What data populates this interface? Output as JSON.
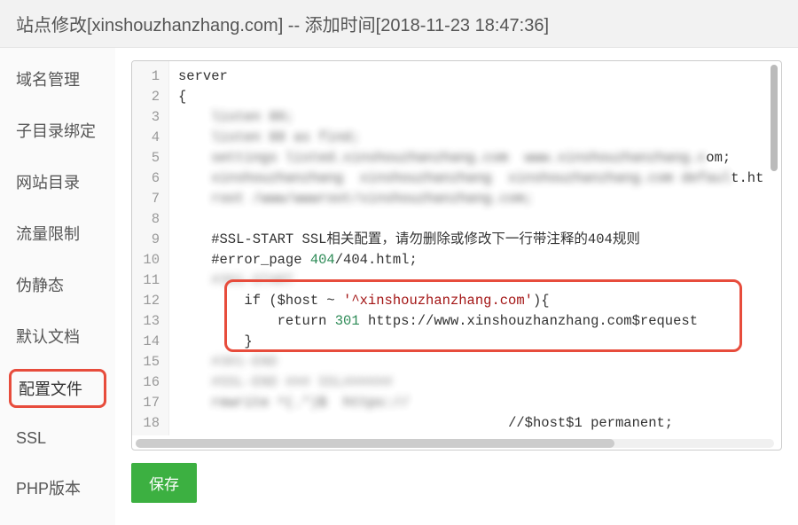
{
  "header": {
    "title": "站点修改[xinshouzhanzhang.com] -- 添加时间[2018-11-23 18:47:36]"
  },
  "sidebar": {
    "items": [
      {
        "label": "域名管理",
        "key": "domain"
      },
      {
        "label": "子目录绑定",
        "key": "subdir"
      },
      {
        "label": "网站目录",
        "key": "sitedir"
      },
      {
        "label": "流量限制",
        "key": "traffic"
      },
      {
        "label": "伪静态",
        "key": "rewrite"
      },
      {
        "label": "默认文档",
        "key": "default-doc"
      },
      {
        "label": "配置文件",
        "key": "config",
        "active": true
      },
      {
        "label": "SSL",
        "key": "ssl"
      },
      {
        "label": "PHP版本",
        "key": "php"
      }
    ]
  },
  "editor": {
    "buttons": {
      "save": "保存"
    },
    "line_numbers": [
      "1",
      "2",
      "3",
      "4",
      "5",
      "6",
      "7",
      "8",
      "9",
      "10",
      "11",
      "12",
      "13",
      "14",
      "15",
      "16",
      "17",
      "18"
    ],
    "lines": [
      {
        "n": 1,
        "text": "server",
        "type": "plain"
      },
      {
        "n": 2,
        "text": "{",
        "type": "plain"
      },
      {
        "n": 3,
        "text": "    listen 80;",
        "type": "blurred"
      },
      {
        "n": 4,
        "text": "    listen 88 as find;",
        "type": "blurred"
      },
      {
        "n": 5,
        "text": "    settings listed.xinshouzhanzhang.com  www.xinshouzhanzhang.com;",
        "type": "blurred-tail",
        "tail": "om;"
      },
      {
        "n": 6,
        "text": "    xinshouzhanzhang  xinshouzhanzhang  xinshouzhanzhang.com default.ht",
        "type": "blurred-tail",
        "tail": "t.ht"
      },
      {
        "n": 7,
        "text": "    root /www/wwwroot/xinshouzhanzhang.com;",
        "type": "blurred"
      },
      {
        "n": 8,
        "text": "    ",
        "type": "plain"
      },
      {
        "n": 9,
        "text": "    #SSL-START SSL相关配置，请勿删除或修改下一行带注释的404规则",
        "type": "comment"
      },
      {
        "n": 10,
        "text_pre": "    #error_page ",
        "num": "404",
        "text_post": "/404.html;",
        "type": "errpage"
      },
      {
        "n": 11,
        "text": "    #301-START",
        "type": "blurred-comment"
      },
      {
        "n": 12,
        "text_pre": "        if ($host ~ ",
        "str": "'^xinshouzhanzhang.com'",
        "text_post": "){",
        "type": "if"
      },
      {
        "n": 13,
        "text_pre": "            return ",
        "num": "301",
        "text_post": " https://www.xinshouzhanzhang.com$request",
        "type": "return"
      },
      {
        "n": 14,
        "text": "        }",
        "type": "plain"
      },
      {
        "n": 15,
        "text": "    #301-END",
        "type": "blurred-comment"
      },
      {
        "n": 16,
        "text": "    #SSL-END ### SSL######",
        "type": "blurred-comment"
      },
      {
        "n": 17,
        "text": "    rewrite ^(.*)$  https://",
        "type": "blurred"
      },
      {
        "n": 18,
        "text_pre": "                                        ",
        "tail": "//$host$1 permanent;",
        "type": "blurred-tail2"
      }
    ]
  }
}
